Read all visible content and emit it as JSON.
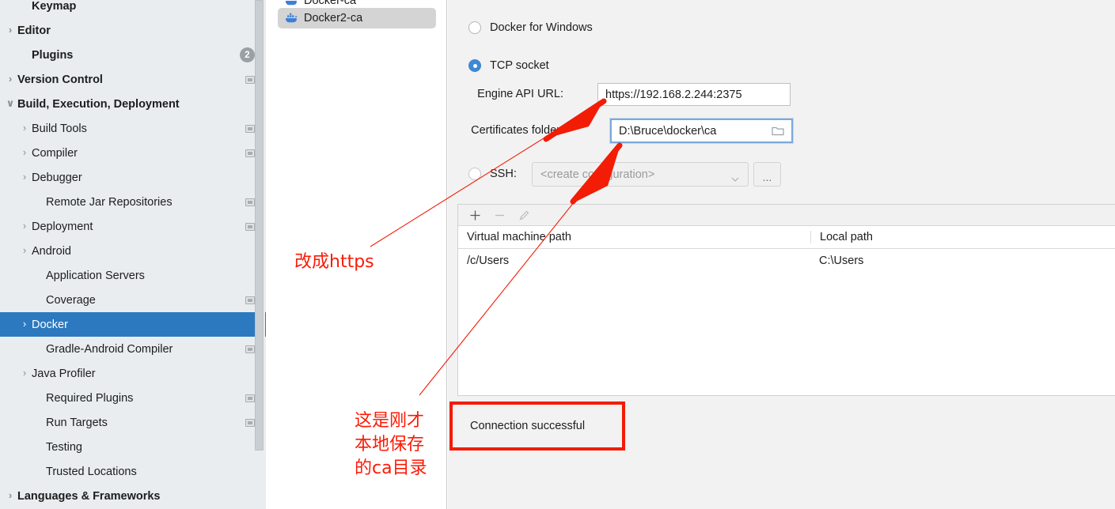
{
  "sidebar": {
    "items": [
      {
        "label": "Keymap",
        "indent": 1,
        "arrow": "",
        "bold": true,
        "badge": "",
        "copy": false,
        "selected": false,
        "clipped": true
      },
      {
        "label": "Editor",
        "indent": 0,
        "arrow": "›",
        "bold": true,
        "badge": "",
        "copy": false,
        "selected": false
      },
      {
        "label": "Plugins",
        "indent": 1,
        "arrow": "",
        "bold": true,
        "badge": "2",
        "copy": false,
        "selected": false
      },
      {
        "label": "Version Control",
        "indent": 0,
        "arrow": "›",
        "bold": true,
        "badge": "",
        "copy": true,
        "selected": false
      },
      {
        "label": "Build, Execution, Deployment",
        "indent": 0,
        "arrow": "∨",
        "bold": true,
        "badge": "",
        "copy": false,
        "selected": false
      },
      {
        "label": "Build Tools",
        "indent": 1,
        "arrow": "›",
        "bold": false,
        "badge": "",
        "copy": true,
        "selected": false
      },
      {
        "label": "Compiler",
        "indent": 1,
        "arrow": "›",
        "bold": false,
        "badge": "",
        "copy": true,
        "selected": false
      },
      {
        "label": "Debugger",
        "indent": 1,
        "arrow": "›",
        "bold": false,
        "badge": "",
        "copy": false,
        "selected": false
      },
      {
        "label": "Remote Jar Repositories",
        "indent": 2,
        "arrow": "",
        "bold": false,
        "badge": "",
        "copy": true,
        "selected": false
      },
      {
        "label": "Deployment",
        "indent": 1,
        "arrow": "›",
        "bold": false,
        "badge": "",
        "copy": true,
        "selected": false
      },
      {
        "label": "Android",
        "indent": 1,
        "arrow": "›",
        "bold": false,
        "badge": "",
        "copy": false,
        "selected": false
      },
      {
        "label": "Application Servers",
        "indent": 2,
        "arrow": "",
        "bold": false,
        "badge": "",
        "copy": false,
        "selected": false
      },
      {
        "label": "Coverage",
        "indent": 2,
        "arrow": "",
        "bold": false,
        "badge": "",
        "copy": true,
        "selected": false
      },
      {
        "label": "Docker",
        "indent": 1,
        "arrow": "›",
        "bold": false,
        "badge": "",
        "copy": false,
        "selected": true
      },
      {
        "label": "Gradle-Android Compiler",
        "indent": 2,
        "arrow": "",
        "bold": false,
        "badge": "",
        "copy": true,
        "selected": false
      },
      {
        "label": "Java Profiler",
        "indent": 1,
        "arrow": "›",
        "bold": false,
        "badge": "",
        "copy": false,
        "selected": false
      },
      {
        "label": "Required Plugins",
        "indent": 2,
        "arrow": "",
        "bold": false,
        "badge": "",
        "copy": true,
        "selected": false
      },
      {
        "label": "Run Targets",
        "indent": 2,
        "arrow": "",
        "bold": false,
        "badge": "",
        "copy": true,
        "selected": false
      },
      {
        "label": "Testing",
        "indent": 2,
        "arrow": "",
        "bold": false,
        "badge": "",
        "copy": false,
        "selected": false
      },
      {
        "label": "Trusted Locations",
        "indent": 2,
        "arrow": "",
        "bold": false,
        "badge": "",
        "copy": false,
        "selected": false
      },
      {
        "label": "Languages & Frameworks",
        "indent": 0,
        "arrow": "›",
        "bold": true,
        "badge": "",
        "copy": false,
        "selected": false
      }
    ],
    "selection_color": "#2c79bf",
    "background_color": "#e9edf0"
  },
  "connections_list": {
    "items": [
      {
        "label": "Docker-ca",
        "selected": false
      },
      {
        "label": "Docker2-ca",
        "selected": true
      }
    ]
  },
  "settings": {
    "connection_type": {
      "options": [
        {
          "label": "Docker for Windows",
          "selected": false
        },
        {
          "label": "TCP socket",
          "selected": true
        },
        {
          "label": "SSH:",
          "selected": false
        }
      ]
    },
    "engine_api_url": {
      "label": "Engine API URL:",
      "value": "https://192.168.2.244:2375"
    },
    "certificates_folder": {
      "label": "Certificates folder:",
      "value": "D:\\Bruce\\docker\\ca",
      "icon": "folder-icon"
    },
    "ssh_config": {
      "label": "SSH:",
      "placeholder": "<create configuration>",
      "value": "<create configuration>",
      "more_button": "..."
    }
  },
  "path_mappings": {
    "toolbar": [
      {
        "name": "add-icon",
        "glyph": "+"
      },
      {
        "name": "remove-icon",
        "glyph": "−"
      },
      {
        "name": "edit-icon",
        "glyph": "✎"
      }
    ],
    "columns": [
      "Virtual machine path",
      "Local path"
    ],
    "rows": [
      {
        "virtual_machine_path": "/c/Users",
        "local_path": "C:\\Users"
      }
    ]
  },
  "status": {
    "message": "Connection successful",
    "highlight_color": "#f31c05"
  },
  "annotations": [
    {
      "name": "annotation-change-to-https",
      "text": "改成https",
      "color": "#fc1a06"
    },
    {
      "name": "annotation-local-ca-dir",
      "text": "这是刚才\n本地保存\n的ca目录",
      "color": "#fc1a06"
    }
  ]
}
